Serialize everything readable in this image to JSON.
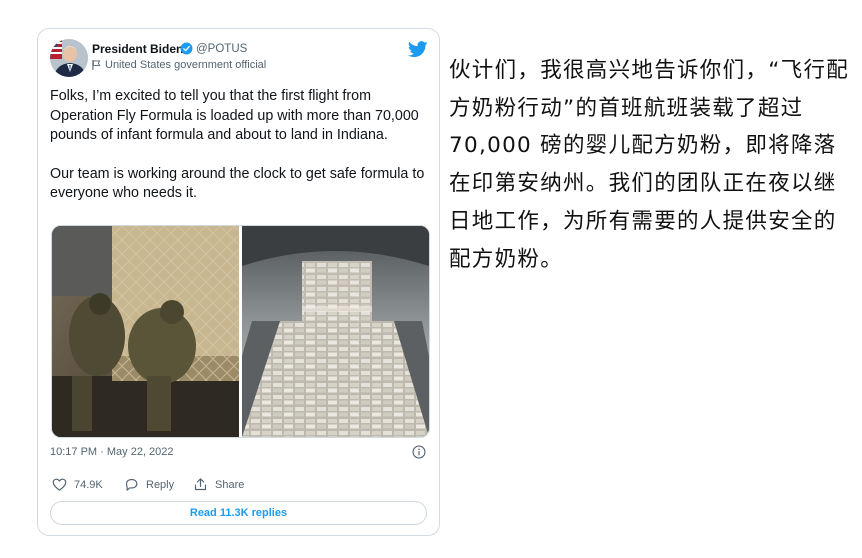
{
  "tweet": {
    "author_name": "President Biden",
    "handle": "@POTUS",
    "account_label": "United States government official",
    "paragraphs": [
      "Folks, I’m excited to tell you that the first flight from Operation Fly Formula is loaded up with more than 70,000 pounds of infant formula and about to land in Indiana.",
      "Our team is working around the clock to get safe formula to everyone who needs it."
    ],
    "timestamp": "10:17 PM · May 22, 2022",
    "likes": "74.9K",
    "reply_label": "Reply",
    "share_label": "Share",
    "read_replies_label": "Read 11.3K replies"
  },
  "translation": "伙计们，我很高兴地告诉你们，“飞行配方奶粉行动”的首班航班装载了超过 70,000 磅的婴儿配方奶粉，即将降落在印第安纳州。我们的团队正在夜以继日地工作，为所有需要的人提供安全的配方奶粉。",
  "icons": {
    "verified": "verified-badge-icon",
    "flag": "flag-icon",
    "brand": "twitter-bird-icon",
    "info": "info-icon",
    "like": "heart-icon",
    "reply": "speech-bubble-icon",
    "share": "share-icon"
  },
  "colors": {
    "accent": "#1d9bf0",
    "secondary_text": "#536471",
    "primary_text": "#0f1419",
    "border": "#cfd9de"
  }
}
